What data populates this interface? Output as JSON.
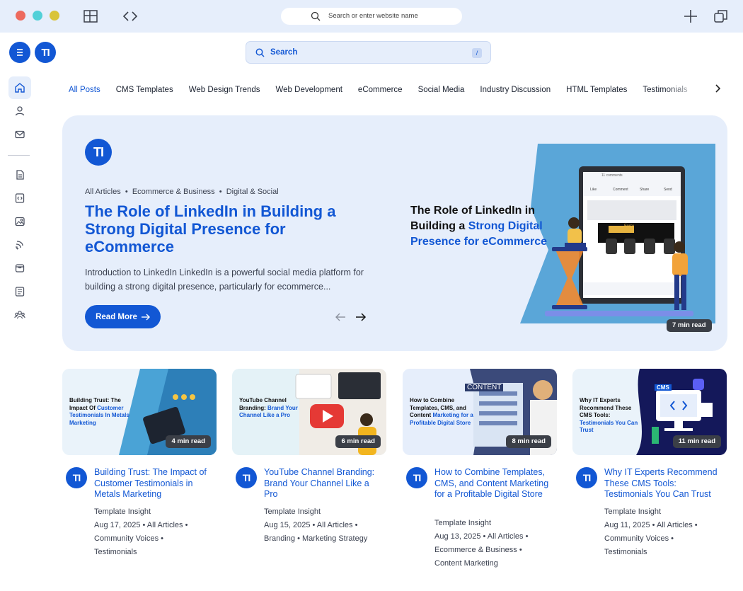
{
  "browser": {
    "url_placeholder": "Search or enter website name",
    "colors": {
      "close": "#ed6a5e",
      "minimize": "#52d0d8",
      "zoom": "#d9c43a"
    },
    "icons": [
      "layout-icon",
      "code-icon",
      "plus-icon",
      "duplicate-tab-icon"
    ]
  },
  "header": {
    "logo_text": "TI",
    "search_label": "Search",
    "search_shortcut": "/"
  },
  "sidebar": {
    "items": [
      {
        "icon": "home-icon",
        "active": true
      },
      {
        "icon": "user-icon",
        "active": false
      },
      {
        "icon": "mail-icon",
        "active": false
      },
      {
        "icon": "document-icon",
        "active": false
      },
      {
        "icon": "code-file-icon",
        "active": false
      },
      {
        "icon": "image-icon",
        "active": false
      },
      {
        "icon": "share-icon",
        "active": false
      },
      {
        "icon": "inbox-icon",
        "active": false
      },
      {
        "icon": "news-icon",
        "active": false
      },
      {
        "icon": "community-icon",
        "active": false
      }
    ]
  },
  "tabs": [
    "All Posts",
    "CMS Templates",
    "Web Design Trends",
    "Web Development",
    "eCommerce",
    "Social Media",
    "Industry Discussion",
    "HTML Templates",
    "Testimonials"
  ],
  "hero": {
    "logo_text": "TI",
    "crumbs": [
      "All Articles",
      "Ecommerce & Business",
      "Digital & Social"
    ],
    "title": "The Role of LinkedIn in Building a Strong Digital Presence for eCommerce",
    "excerpt": "Introduction to LinkedIn LinkedIn is a powerful social media platform for building a strong digital presence, particularly for ecommerce...",
    "read_more": "Read More",
    "image_title_dark": "The Role of LinkedIn in Building a",
    "image_title_blue": "Strong Digital Presence for eCommerce",
    "image_ui": {
      "comments": "11 comments",
      "actions": [
        "Like",
        "Comment",
        "Share",
        "Send"
      ],
      "banner": "Ferry"
    },
    "read_time": "7 min read"
  },
  "cards": [
    {
      "img_dark": "Building Trust: The Impact Of",
      "img_blue": "Customer Testimonials In Metals Marketing",
      "read_time": "4 min read",
      "title": "Building Trust: The Impact of Customer Testimonials in Metals Marketing",
      "author": "Template Insight",
      "meta_lines": [
        "Aug 17, 2025  •  All Articles  •",
        "Community Voices  •",
        "Testimonials"
      ]
    },
    {
      "img_dark": "YouTube Channel Branding:",
      "img_blue": "Brand Your Channel Like a Pro",
      "read_time": "6 min read",
      "title": "YouTube Channel Branding: Brand Your Channel Like a Pro",
      "author": "Template Insight",
      "meta_lines": [
        "Aug 15, 2025  •  All Articles  •",
        "Branding  •  Marketing Strategy"
      ]
    },
    {
      "img_dark": "How to Combine Templates, CMS, and Content",
      "img_blue": "Marketing for a Profitable Digital Store",
      "img_label": "CONTENT",
      "read_time": "8 min read",
      "title": "How to Combine Templates, CMS, and Content Marketing for a Profitable Digital Store",
      "author": "Template Insight",
      "meta_lines": [
        "Aug 13, 2025  •  All Articles  •",
        "Ecommerce & Business  •",
        "Content Marketing"
      ]
    },
    {
      "img_dark": "Why IT Experts Recommend These CMS Tools:",
      "img_blue": "Testimonials You Can Trust",
      "img_label": "CMS",
      "read_time": "11 min read",
      "title": "Why IT Experts Recommend These CMS Tools: Testimonials You Can Trust",
      "author": "Template Insight",
      "meta_lines": [
        "Aug 11, 2025  •  All Articles  •",
        "Community Voices  •",
        "Testimonials"
      ]
    }
  ]
}
